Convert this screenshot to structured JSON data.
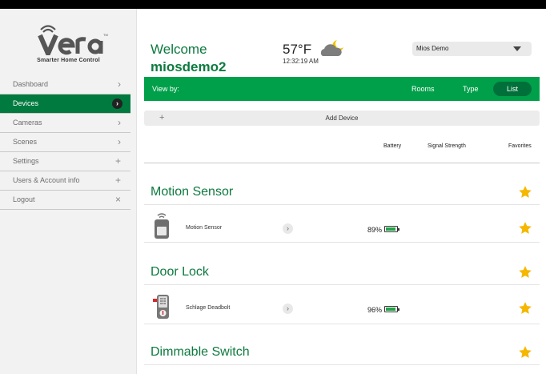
{
  "brand": {
    "name": "vera",
    "tagline": "Smarter Home Control",
    "accent": "#007a3f",
    "bar_green": "#00a04a"
  },
  "sidebar": {
    "items": [
      {
        "label": "Dashboard",
        "icon": "chevron-right-icon",
        "glyph": "›",
        "active": false
      },
      {
        "label": "Devices",
        "icon": "chevron-right-icon",
        "glyph": "›",
        "active": true
      },
      {
        "label": "Cameras",
        "icon": "chevron-right-icon",
        "glyph": "›",
        "active": false
      },
      {
        "label": "Scenes",
        "icon": "chevron-right-icon",
        "glyph": "›",
        "active": false
      },
      {
        "label": "Settings",
        "icon": "plus-icon",
        "glyph": "+",
        "active": false
      },
      {
        "label": "Users & Account info",
        "icon": "plus-icon",
        "glyph": "+",
        "active": false
      },
      {
        "label": "Logout",
        "icon": "close-icon",
        "glyph": "×",
        "active": false
      }
    ]
  },
  "header": {
    "welcome": "Welcome",
    "username": "miosdemo2",
    "temperature": "57°F",
    "time": "12:32:19 AM",
    "weather_icon": "partly-cloudy-night-icon",
    "controller_select": "Mios Demo"
  },
  "viewbar": {
    "label": "View by:",
    "options": [
      "Rooms",
      "Type",
      "List"
    ],
    "selected": "List"
  },
  "add_device": {
    "label": "Add Device"
  },
  "columns": {
    "battery": "Battery",
    "signal": "Signal Strength",
    "favorites": "Favorites"
  },
  "sections": [
    {
      "title": "Motion Sensor",
      "devices": [
        {
          "name": "Motion Sensor",
          "icon": "motion-sensor-icon",
          "battery": "89%",
          "battery_level": 0.89,
          "favorite": true
        }
      ]
    },
    {
      "title": "Door Lock",
      "devices": [
        {
          "name": "Schlage Deadbolt",
          "icon": "door-lock-icon",
          "battery": "96%",
          "battery_level": 0.96,
          "favorite": true
        }
      ]
    },
    {
      "title": "Dimmable Switch",
      "devices": []
    }
  ],
  "colors": {
    "star": "#f5b700",
    "battery_fill": "#22a548"
  }
}
